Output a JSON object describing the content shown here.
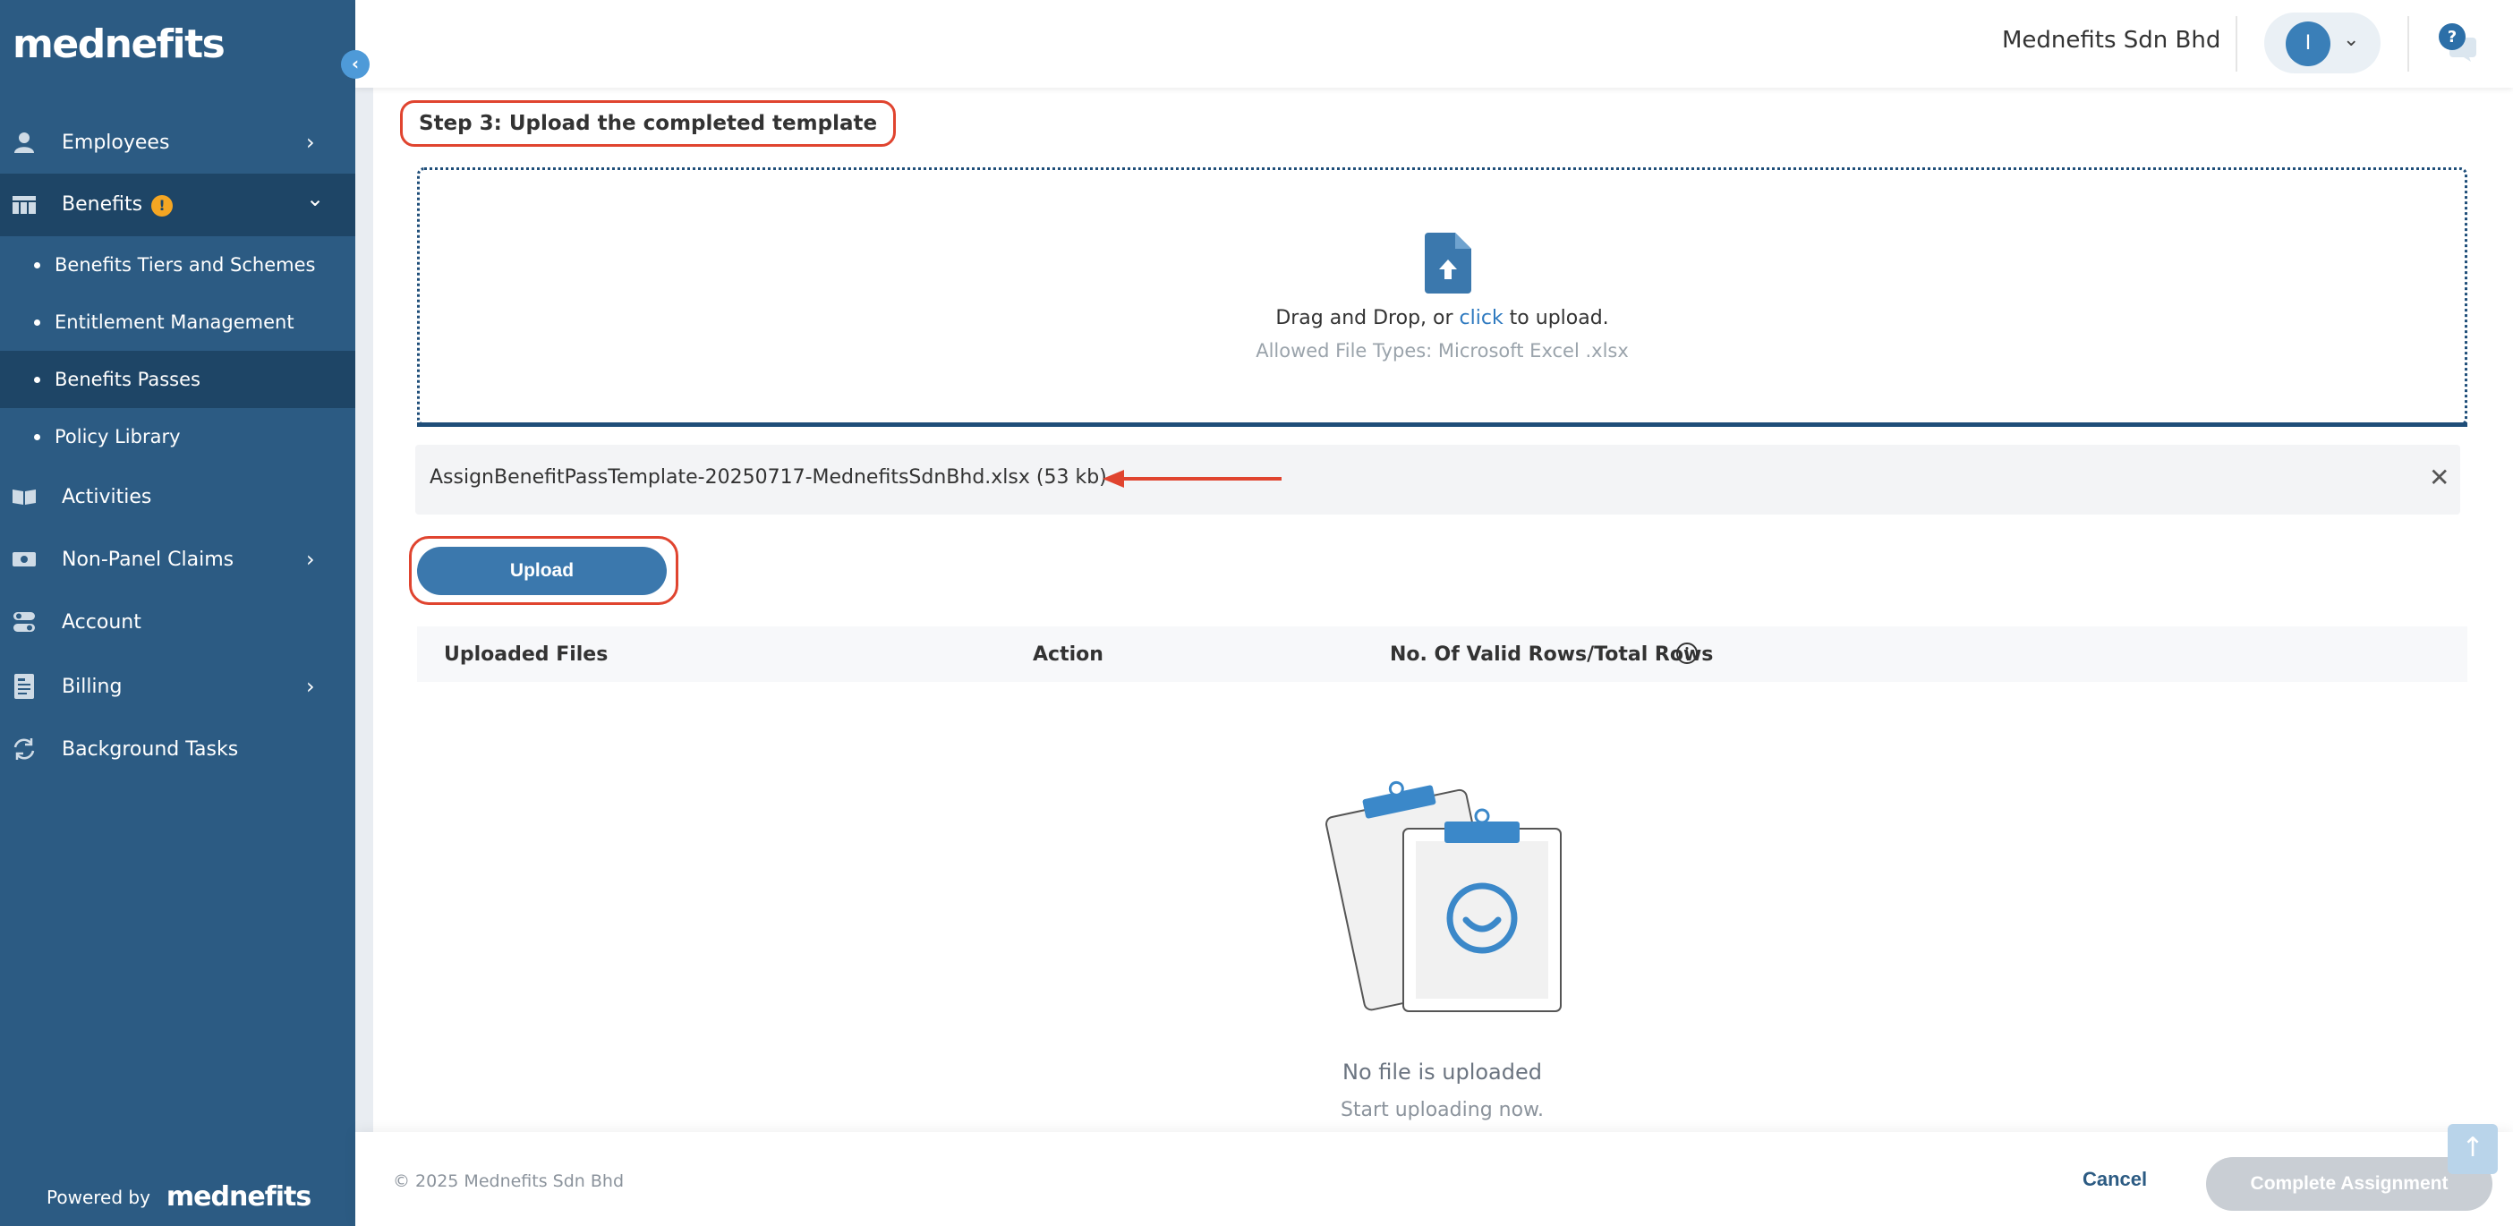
{
  "sidebar": {
    "logo": "mednefits",
    "collapse_glyph": "‹",
    "items": [
      {
        "label": "Employees",
        "icon": "person-icon",
        "chevron": "›"
      },
      {
        "label": "Benefits",
        "icon": "table-icon",
        "chevron": "⌄",
        "badge": "!"
      },
      {
        "label": "Activities",
        "icon": "book-icon"
      },
      {
        "label": "Non-Panel Claims",
        "icon": "cash-icon",
        "chevron": "›"
      },
      {
        "label": "Account",
        "icon": "toggles-icon"
      },
      {
        "label": "Billing",
        "icon": "invoice-icon",
        "chevron": "›"
      },
      {
        "label": "Background Tasks",
        "icon": "sync-icon"
      }
    ],
    "sub_items": [
      {
        "label": "Benefits Tiers and Schemes"
      },
      {
        "label": "Entitlement Management"
      },
      {
        "label": "Benefits Passes"
      },
      {
        "label": "Policy Library"
      }
    ],
    "powered_by": "Powered by",
    "powered_logo": "mednefits"
  },
  "header": {
    "company": "Mednefits Sdn Bhd",
    "avatar_initial": "I",
    "user_chevron": "⌄",
    "help_glyph": "?"
  },
  "step": {
    "title": "Step 3: Upload the completed template"
  },
  "dropzone": {
    "text_before": "Drag and Drop, or ",
    "link": "click",
    "text_after": " to upload.",
    "allowed": "Allowed File Types: Microsoft Excel .xlsx"
  },
  "selected_file": {
    "name": "AssignBenefitPassTemplate-20250717-MednefitsSdnBhd.xlsx (53 kb)",
    "close_glyph": "✕"
  },
  "upload_button": "Upload",
  "table": {
    "columns": [
      "Uploaded Files",
      "Action",
      "No. Of Valid Rows/Total Rows"
    ]
  },
  "empty": {
    "title": "No file is uploaded",
    "subtitle": "Start uploading now."
  },
  "footer": {
    "copyright": "© 2025 Mednefits Sdn Bhd",
    "cancel": "Cancel",
    "complete": "Complete Assignment",
    "scroll_top_glyph": "↑"
  },
  "colors": {
    "sidebar": "#2c5b83",
    "sidebar_active": "#1e4566",
    "primary": "#3b78ad",
    "annotation": "#e0442f",
    "warning": "#f5a623"
  }
}
